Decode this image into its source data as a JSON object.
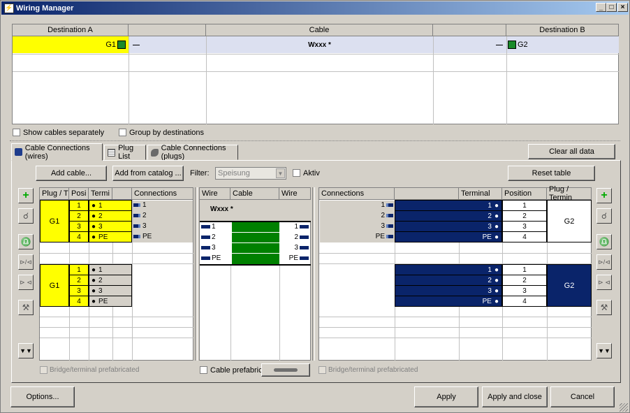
{
  "window": {
    "title": "Wiring Manager",
    "colors": {
      "yellow": "#ffff00",
      "navy": "#0a246a",
      "green": "#008000",
      "selection": "#dce0f0"
    }
  },
  "top_table": {
    "headers": [
      "Destination A",
      "Cable",
      "Destination B"
    ],
    "row": {
      "dest_a": "G1",
      "cable": "Wxxx *",
      "dest_b": "G2"
    }
  },
  "options": {
    "show_cables_separately": "Show cables separately",
    "group_by_destinations": "Group by destinations"
  },
  "tabs": [
    {
      "label": "Cable Connections (wires)",
      "icon": "cable-wires-icon"
    },
    {
      "label": "Plug List",
      "icon": "table-icon"
    },
    {
      "label": "Cable Connections (plugs)",
      "icon": "cable-plugs-icon"
    }
  ],
  "toolbar": {
    "clear_all": "Clear all data",
    "add_cable": "Add cable...",
    "add_from_catalog": "Add from catalog ...",
    "filter_label": "Filter:",
    "filter_value": "Speisung",
    "aktiv": "Aktiv",
    "reset_table": "Reset table"
  },
  "left_grid": {
    "headers": [
      "Plug / T",
      "Posi",
      "Termi",
      "Connections"
    ],
    "group1": {
      "plug": "G1",
      "rows": [
        {
          "pos": "1",
          "term": "1",
          "conn": "1"
        },
        {
          "pos": "2",
          "term": "2",
          "conn": "2"
        },
        {
          "pos": "3",
          "term": "3",
          "conn": "3"
        },
        {
          "pos": "4",
          "term": "PE",
          "conn": "PE"
        }
      ]
    },
    "group2": {
      "plug": "G1",
      "rows": [
        {
          "pos": "1",
          "term": "1"
        },
        {
          "pos": "2",
          "term": "2"
        },
        {
          "pos": "3",
          "term": "3"
        },
        {
          "pos": "4",
          "term": "PE"
        }
      ]
    },
    "bridge": "Bridge/terminal prefabricated"
  },
  "middle_grid": {
    "headers": [
      "Wire",
      "Cable",
      "Wire"
    ],
    "cable": "Wxxx *",
    "wires": [
      "1",
      "2",
      "3",
      "PE"
    ],
    "prefab": "Cable prefabricate"
  },
  "right_grid": {
    "headers": [
      "Connections",
      "",
      "Terminal",
      "Position",
      "Plug / Termin"
    ],
    "group1": {
      "plug": "G2",
      "rows": [
        {
          "conn": "1",
          "term": "1",
          "pos": "1"
        },
        {
          "conn": "2",
          "term": "2",
          "pos": "2"
        },
        {
          "conn": "3",
          "term": "3",
          "pos": "3"
        },
        {
          "conn": "PE",
          "term": "PE",
          "pos": "4"
        }
      ]
    },
    "group2": {
      "plug": "G2",
      "rows": [
        {
          "term": "1",
          "pos": "1"
        },
        {
          "term": "2",
          "pos": "2"
        },
        {
          "term": "3",
          "pos": "3"
        },
        {
          "term": "PE",
          "pos": "4"
        }
      ]
    },
    "bridge": "Bridge/terminal prefabricated"
  },
  "footer": {
    "options": "Options...",
    "apply": "Apply",
    "apply_close": "Apply and close",
    "cancel": "Cancel"
  }
}
